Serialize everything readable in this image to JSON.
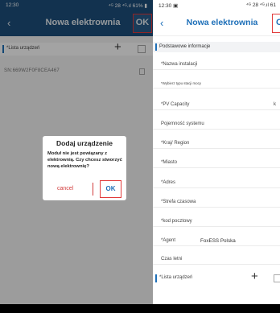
{
  "left_screen": {
    "status": {
      "time": "12:30",
      "indicators": "⁴ᴳ 28 ⁴ᴳ.ıl 61% ▮"
    },
    "header": {
      "back_icon": "‹",
      "title": "Nowa elektrownia",
      "ok_label": "OK"
    },
    "device_list": {
      "label": "*Lista urządzeń",
      "add_icon": "+"
    },
    "serial": {
      "value": "SN:669W2F0F8CEA467"
    },
    "dialog": {
      "title": "Dodaj urządzenie",
      "message": "Moduł nie jest powiązany z elektrownią. Czy chcesz stworzyć nową elektrownię?",
      "cancel_label": "cancel",
      "ok_label": "OK"
    }
  },
  "right_screen": {
    "status": {
      "time": "12:30 ▣",
      "indicators": "⁴ᴳ 28 ⁴ᴳ.ıl 61"
    },
    "header": {
      "back_icon": "‹",
      "title": "Nowa elektrownia",
      "ok_label": "O"
    },
    "section_title": "Podstawowe informacje",
    "fields": [
      {
        "label": "*Nazwa instalacji"
      },
      {
        "label": "*Wybierz typu stacji mocy"
      },
      {
        "label": "*PV Capacity",
        "right": "k"
      },
      {
        "label": "Pojemność systemu"
      },
      {
        "label": "*Kraj/ Region"
      },
      {
        "label": "*Miasto"
      },
      {
        "label": "*Adres"
      },
      {
        "label": "*Strefa czasowa"
      },
      {
        "label": "*kod pocztowy"
      },
      {
        "label": "*Agent",
        "value": "FoxESS Polska"
      },
      {
        "label": "Czas letni"
      }
    ],
    "device_list": {
      "label": "*Lista urządzeń",
      "add_icon": "+"
    }
  },
  "colors": {
    "brand": "#1d4f7c",
    "accent": "#1d6fb8",
    "highlight": "#e23b3b",
    "cancel": "#d23c3c"
  }
}
